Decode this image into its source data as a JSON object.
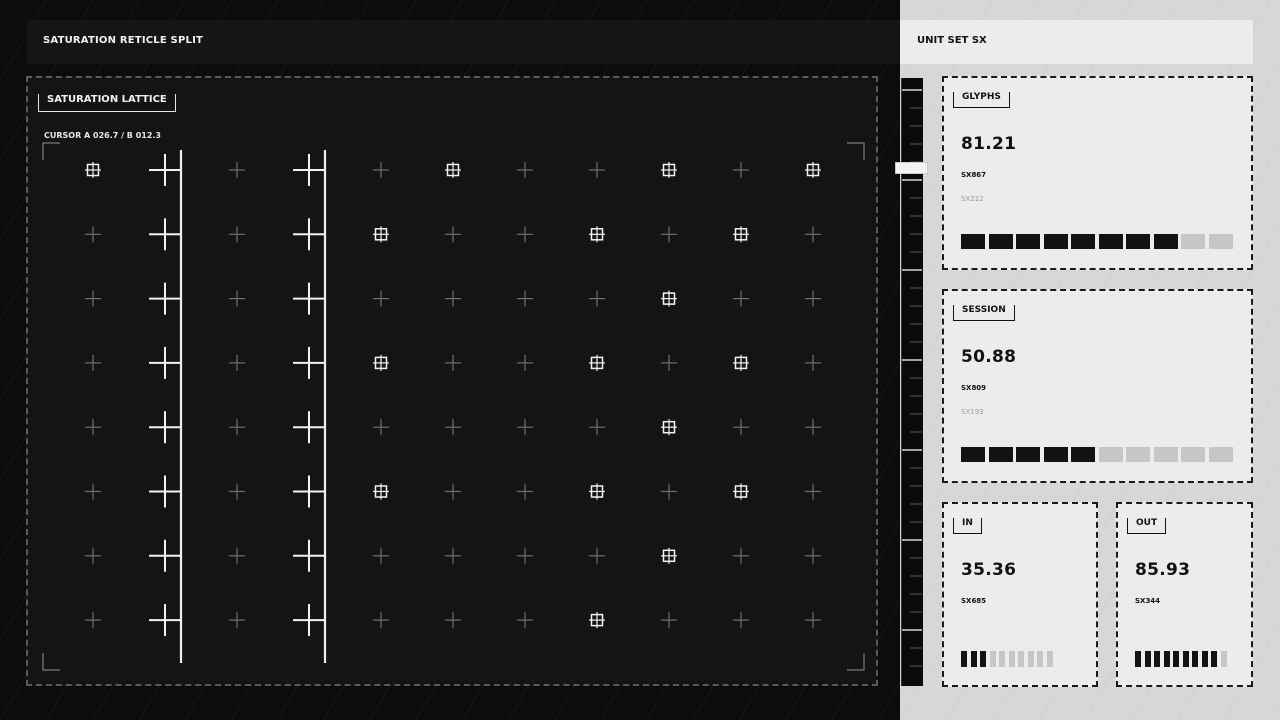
{
  "header": {
    "left_title": "SATURATION RETICLE SPLIT",
    "right_title": "UNIT SET SX"
  },
  "lattice": {
    "label": "SATURATION LATTICE",
    "cursor": "CURSOR A 026.7 / B 012.3",
    "rows": 8,
    "cols": 11,
    "bold_columns": [
      1,
      3
    ],
    "divider_after_columns": [
      1,
      3
    ],
    "boxed_cells": [
      [
        0,
        0
      ],
      [
        0,
        5
      ],
      [
        0,
        8
      ],
      [
        0,
        10
      ],
      [
        1,
        4
      ],
      [
        1,
        7
      ],
      [
        1,
        9
      ],
      [
        2,
        8
      ],
      [
        3,
        4
      ],
      [
        3,
        7
      ],
      [
        3,
        9
      ],
      [
        4,
        8
      ],
      [
        5,
        4
      ],
      [
        5,
        7
      ],
      [
        5,
        9
      ],
      [
        6,
        8
      ],
      [
        7,
        7
      ]
    ]
  },
  "cards": {
    "glyphs": {
      "label": "GLYPHS",
      "value": "81.21",
      "code": "SX867",
      "code_secondary": "SX212",
      "meter_total": 10,
      "meter_filled": 8
    },
    "session": {
      "label": "SESSION",
      "value": "50.88",
      "code": "SX809",
      "code_secondary": "SX193",
      "meter_total": 10,
      "meter_filled": 5
    },
    "in": {
      "label": "IN",
      "value": "35.36",
      "code": "SX685",
      "meter_total": 10,
      "meter_filled": 3
    },
    "out": {
      "label": "OUT",
      "value": "85.93",
      "code": "SX344",
      "meter_total": 10,
      "meter_filled": 9
    }
  },
  "colors": {
    "dark_bg": "#0c0c0c",
    "light_bg": "#d6d8d5",
    "card_bg": "#ecedea",
    "ink": "#121212",
    "meter_off": "#c6c7c4"
  }
}
